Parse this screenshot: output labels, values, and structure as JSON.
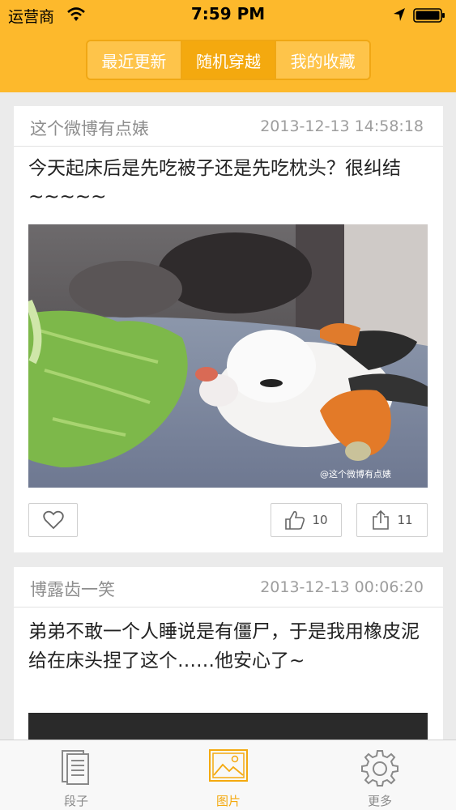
{
  "status_bar": {
    "carrier": "运营商",
    "time": "7:59 PM"
  },
  "segments": [
    {
      "label": "最近更新",
      "active": false
    },
    {
      "label": "随机穿越",
      "active": true
    },
    {
      "label": "我的收藏",
      "active": false
    }
  ],
  "posts": [
    {
      "source": "这个微博有点婊",
      "time": "2013-12-13 14:58:18",
      "text": "今天起床后是先吃被子还是先吃枕头？很纠结~~~~~",
      "watermark": "@这个微博有点婊",
      "likes": "10",
      "shares": "11"
    },
    {
      "source": "博露齿一笑",
      "time": "2013-12-13 00:06:20",
      "text": "弟弟不敢一个人睡说是有僵尸，于是我用橡皮泥给在床头捏了这个……他安心了~"
    }
  ],
  "tabbar": [
    {
      "label": "段子",
      "icon": "document-icon",
      "active": false
    },
    {
      "label": "图片",
      "icon": "picture-icon",
      "active": true
    },
    {
      "label": "更多",
      "icon": "gear-icon",
      "active": false
    }
  ],
  "colors": {
    "accent": "#fdb92c",
    "accent_dark": "#f4a90f",
    "background": "#ebebeb"
  }
}
